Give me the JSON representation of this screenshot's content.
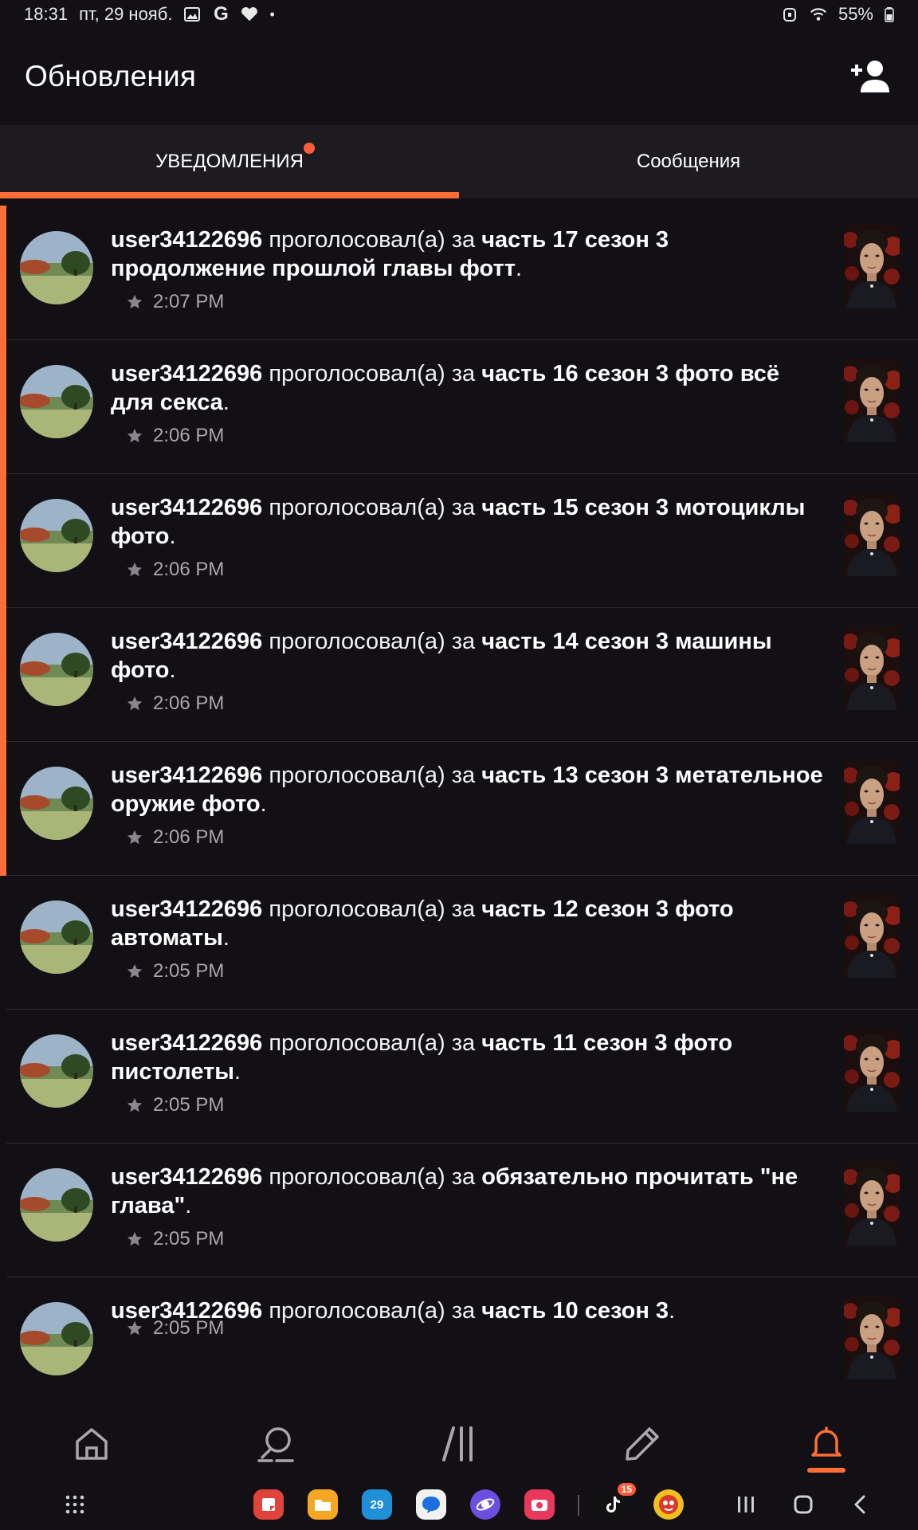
{
  "status_bar": {
    "time": "18:31",
    "date": "пт, 29 нояб.",
    "g_glyph": "G",
    "battery": "55%",
    "icons": [
      "gallery-icon",
      "google-icon",
      "heart-icon",
      "dot-icon",
      "alarm-icon",
      "wifi-icon",
      "battery-icon"
    ]
  },
  "app_bar": {
    "title": "Обновления",
    "action_icon": "add-user-icon"
  },
  "tabs": [
    {
      "label": "УВЕДОМЛЕНИЯ",
      "active": true,
      "badge": true
    },
    {
      "label": "Сообщения",
      "active": false,
      "badge": false
    }
  ],
  "notifications": [
    {
      "user": "user34122696",
      "action": " проголосовал(а) за ",
      "title": "часть 17 сезон 3 продолжение прошлой главы фотт",
      "end": ".",
      "time": "2:07 PM",
      "unread": true
    },
    {
      "user": "user34122696",
      "action": " проголосовал(а) за ",
      "title": "часть 16 сезон 3 фото всё для секса",
      "end": ".",
      "time": "2:06 PM",
      "unread": true
    },
    {
      "user": "user34122696",
      "action": " проголосовал(а) за ",
      "title": "часть 15 сезон 3 мотоциклы фото",
      "end": ".",
      "time": "2:06 PM",
      "unread": true
    },
    {
      "user": "user34122696",
      "action": " проголосовал(а) за ",
      "title": "часть 14 сезон 3 машины фото",
      "end": ".",
      "time": "2:06 PM",
      "unread": true
    },
    {
      "user": "user34122696",
      "action": " проголосовал(а) за ",
      "title": "часть 13 сезон 3 метательное оружие фото",
      "end": ".",
      "time": "2:06 PM",
      "unread": true
    },
    {
      "user": "user34122696",
      "action": " проголосовал(а) за ",
      "title": "часть 12 сезон 3 фото автоматы",
      "end": ".",
      "time": "2:05 PM",
      "unread": false
    },
    {
      "user": "user34122696",
      "action": " проголосовал(а) за ",
      "title": "часть 11 сезон 3 фото пистолеты",
      "end": ".",
      "time": "2:05 PM",
      "unread": false
    },
    {
      "user": "user34122696",
      "action": " проголосовал(а) за ",
      "title": "обязательно прочитать \"не глава\"",
      "end": ".",
      "time": "2:05 PM",
      "unread": false
    },
    {
      "user": "user34122696",
      "action": " проголосовал(а) за ",
      "title": "часть 10 сезон 3",
      "end": ".",
      "time": "2:05 PM",
      "unread": false
    }
  ],
  "bottom_nav": [
    {
      "icon": "home-icon",
      "active": false
    },
    {
      "icon": "search-icon",
      "active": false
    },
    {
      "icon": "library-icon",
      "active": false
    },
    {
      "icon": "write-icon",
      "active": false
    },
    {
      "icon": "bell-icon",
      "active": true
    }
  ],
  "dock": {
    "calendar_day": "29",
    "tiktok_badge": "15",
    "apps": [
      "app-drawer-icon",
      "notes-app-icon",
      "files-app-icon",
      "calendar-app-icon",
      "messages-app-icon",
      "internet-app-icon",
      "camera-app-icon",
      "tiktok-app-icon",
      "game-app-icon"
    ],
    "system_buttons": [
      "recents-icon",
      "home-button-icon",
      "back-icon"
    ]
  },
  "colors": {
    "accent": "#ff6d36",
    "background": "#121015",
    "tab_bar": "#1d1b20"
  }
}
